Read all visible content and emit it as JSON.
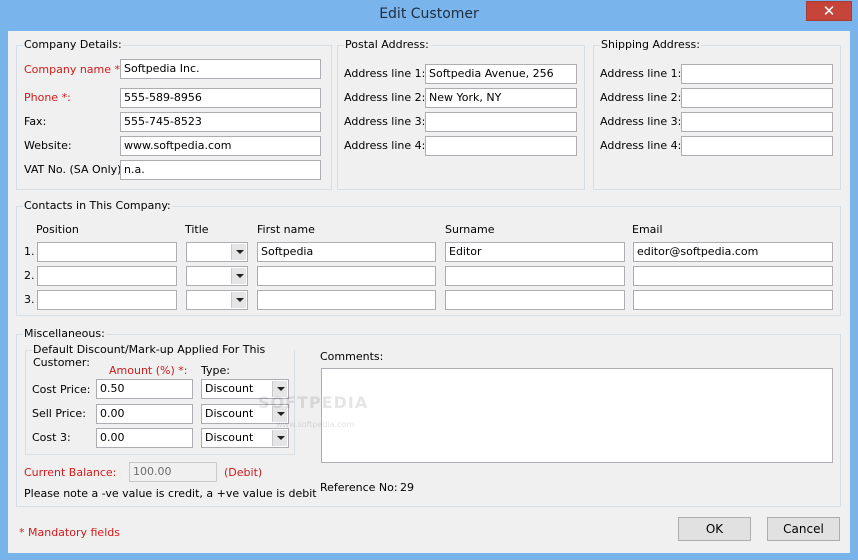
{
  "window": {
    "title": "Edit Customer",
    "close_symbol": "✕"
  },
  "company": {
    "legend": "Company Details:",
    "name_label": "Company name *:",
    "name_value": "Softpedia Inc.",
    "phone_label": "Phone *:",
    "phone_value": "555-589-8956",
    "fax_label": "Fax:",
    "fax_value": "555-745-8523",
    "website_label": "Website:",
    "website_value": "www.softpedia.com",
    "vat_label": "VAT No. (SA Only):",
    "vat_value": "n.a."
  },
  "postal": {
    "legend": "Postal Address:",
    "lines": [
      {
        "label": "Address line 1:",
        "value": "Softpedia Avenue, 256"
      },
      {
        "label": "Address line 2:",
        "value": "New York, NY"
      },
      {
        "label": "Address line 3:",
        "value": ""
      },
      {
        "label": "Address line 4:",
        "value": ""
      }
    ]
  },
  "shipping": {
    "legend": "Shipping Address:",
    "lines": [
      {
        "label": "Address line 1:",
        "value": ""
      },
      {
        "label": "Address line 2:",
        "value": ""
      },
      {
        "label": "Address line 3:",
        "value": ""
      },
      {
        "label": "Address line 4:",
        "value": ""
      }
    ]
  },
  "contacts": {
    "legend": "Contacts in This Company:",
    "headers": {
      "position": "Position",
      "title": "Title",
      "first": "First name",
      "surname": "Surname",
      "email": "Email"
    },
    "rows": [
      {
        "num": "1.",
        "position": "",
        "title": "",
        "first": "Softpedia",
        "surname": "Editor",
        "email": "editor@softpedia.com"
      },
      {
        "num": "2.",
        "position": "",
        "title": "",
        "first": "",
        "surname": "",
        "email": ""
      },
      {
        "num": "3.",
        "position": "",
        "title": "",
        "first": "",
        "surname": "",
        "email": ""
      }
    ]
  },
  "misc": {
    "legend": "Miscellaneous:",
    "discount_legend": "Default Discount/Mark-up Applied For This Customer:",
    "amount_header": "Amount (%) *:",
    "type_header": "Type:",
    "rows": [
      {
        "label": "Cost Price:",
        "amount": "0.50",
        "type": "Discount"
      },
      {
        "label": "Sell Price:",
        "amount": "0.00",
        "type": "Discount"
      },
      {
        "label": "Cost 3:",
        "amount": "0.00",
        "type": "Discount"
      }
    ],
    "balance_label": "Current Balance:",
    "balance_value": "100.00",
    "balance_suffix": "(Debit)",
    "note": "Please note a -ve value is credit, a +ve value is debit",
    "comments_label": "Comments:",
    "comments_value": "",
    "reference_label": "Reference No:",
    "reference_value": "29"
  },
  "footer": {
    "mandatory": "* Mandatory fields",
    "ok": "OK",
    "cancel": "Cancel"
  },
  "watermark": {
    "main": "SOFTPEDIA",
    "sub": "www.softpedia.com"
  }
}
